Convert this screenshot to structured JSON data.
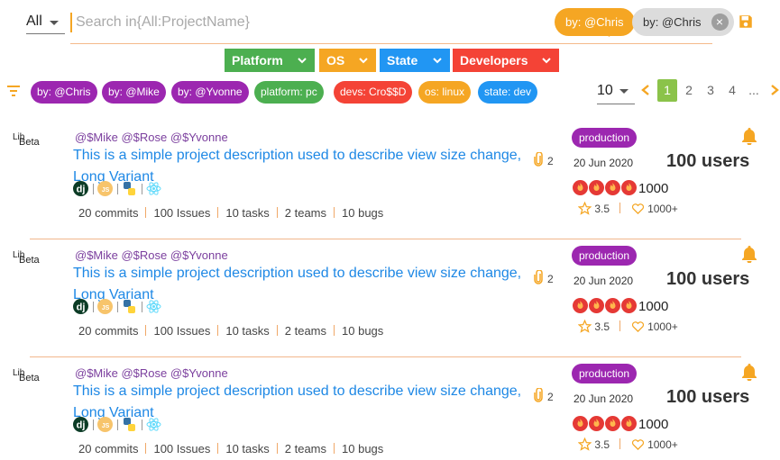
{
  "search": {
    "scope": "All",
    "placeholder": "Search in{All:ProjectName}",
    "chips": [
      "by: @Chris",
      "by: @Chris"
    ]
  },
  "filters": {
    "dropdowns": [
      "Platform",
      "OS",
      "State",
      "Developers"
    ],
    "tags": [
      {
        "label": "by: @Chris",
        "color": "#9c27b0"
      },
      {
        "label": "by: @Mike",
        "color": "#9c27b0"
      },
      {
        "label": "by: @Yvonne",
        "color": "#9c27b0"
      },
      {
        "label": "platform: pc",
        "color": "#4caf50"
      },
      {
        "label": "devs: Cro$$D",
        "color": "#f44336"
      },
      {
        "label": "os: linux",
        "color": "#f5a623"
      },
      {
        "label": "state: dev",
        "color": "#2196f3"
      }
    ]
  },
  "pagination": {
    "per_page": "10",
    "pages": [
      "1",
      "2",
      "3",
      "4",
      "..."
    ],
    "active": "1"
  },
  "projects": [
    {
      "logo_top": "Lib",
      "logo_bottom": "Beta",
      "mentions": "@$Mike @$Rose @$Yvonne",
      "description": "This is a simple project description used to describe view size change, Long Variant",
      "attachments": "2",
      "techs": [
        "django-icon",
        "nodejs-icon",
        "python-icon",
        "react-icon"
      ],
      "commits": "20 commits",
      "issues": "100 Issues",
      "tasks": "10 tasks",
      "teams": "2 teams",
      "bugs": "10 bugs",
      "state": "production",
      "date": "20 Jun 2020",
      "users": "100 users",
      "fire_count": "1000",
      "rating": "3.5",
      "likes": "1000+"
    },
    {
      "logo_top": "Lib",
      "logo_bottom": "Beta",
      "mentions": "@$Mike @$Rose @$Yvonne",
      "description": "This is a simple project description used to describe view size change, Long Variant",
      "attachments": "2",
      "techs": [
        "django-icon",
        "nodejs-icon",
        "python-icon",
        "react-icon"
      ],
      "commits": "20 commits",
      "issues": "100 Issues",
      "tasks": "10 tasks",
      "teams": "2 teams",
      "bugs": "10 bugs",
      "state": "production",
      "date": "20 Jun 2020",
      "users": "100 users",
      "fire_count": "1000",
      "rating": "3.5",
      "likes": "1000+"
    },
    {
      "logo_top": "Lib",
      "logo_bottom": "Beta",
      "mentions": "@$Mike @$Rose @$Yvonne",
      "description": "This is a simple project description used to describe view size change, Long Variant",
      "attachments": "2",
      "techs": [
        "django-icon",
        "nodejs-icon",
        "python-icon",
        "react-icon"
      ],
      "commits": "20 commits",
      "issues": "100 Issues",
      "tasks": "10 tasks",
      "teams": "2 teams",
      "bugs": "10 bugs",
      "state": "production",
      "date": "20 Jun 2020",
      "users": "100 users",
      "fire_count": "1000",
      "rating": "3.5",
      "likes": "1000+"
    }
  ],
  "colors": {
    "accent": "#f5a623",
    "link": "#1e88e5",
    "active_page": "#8bc34a",
    "state_badge": "#9c27b0"
  }
}
